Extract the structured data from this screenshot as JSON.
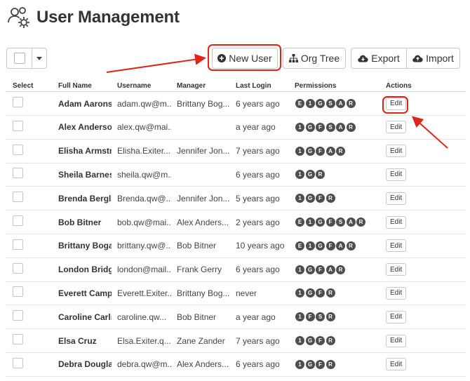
{
  "page": {
    "title": "User Management",
    "accent_color": "#e2231a",
    "badge_color": "#4e4e4e"
  },
  "toolbar": {
    "new_user_label": "New User",
    "org_tree_label": "Org Tree",
    "export_label": "Export",
    "import_label": "Import"
  },
  "table": {
    "headers": {
      "select": "Select",
      "full_name": "Full Name",
      "username": "Username",
      "manager": "Manager",
      "last_login": "Last Login",
      "permissions": "Permissions",
      "actions": "Actions"
    },
    "rows": [
      {
        "full_name": "Adam Aarons",
        "username": "adam.qw@m...",
        "manager": "Brittany Bog...",
        "last_login": "6 years ago",
        "permissions": [
          "E",
          "1",
          "G",
          "S",
          "A",
          "R"
        ],
        "action": "Edit"
      },
      {
        "full_name": "Alex Anderson",
        "username": "alex.qw@mai...",
        "manager": "",
        "last_login": "a year ago",
        "permissions": [
          "1",
          "G",
          "F",
          "S",
          "A",
          "R"
        ],
        "action": "Edit"
      },
      {
        "full_name": "Elisha Armstrong",
        "username": "Elisha.Exiter...",
        "manager": "Jennifer Jon...",
        "last_login": "7 years ago",
        "permissions": [
          "1",
          "G",
          "F",
          "A",
          "R"
        ],
        "action": "Edit"
      },
      {
        "full_name": "Sheila Barnes",
        "username": "sheila.qw@m...",
        "manager": "",
        "last_login": "6 years ago",
        "permissions": [
          "1",
          "G",
          "R"
        ],
        "action": "Edit"
      },
      {
        "full_name": "Brenda Berglan",
        "username": "Brenda.qw@...",
        "manager": "Jennifer Jon...",
        "last_login": "5 years ago",
        "permissions": [
          "1",
          "G",
          "F",
          "R"
        ],
        "action": "Edit"
      },
      {
        "full_name": "Bob Bitner",
        "username": "bob.qw@mai...",
        "manager": "Alex Anders...",
        "last_login": "2 years ago",
        "permissions": [
          "E",
          "1",
          "G",
          "F",
          "S",
          "A",
          "R"
        ],
        "action": "Edit"
      },
      {
        "full_name": "Brittany Bogart",
        "username": "brittany.qw@...",
        "manager": "Bob Bitner",
        "last_login": "10 years ago",
        "permissions": [
          "E",
          "1",
          "G",
          "F",
          "A",
          "R"
        ],
        "action": "Edit"
      },
      {
        "full_name": "London Bridges",
        "username": "london@mail...",
        "manager": "Frank Gerry",
        "last_login": "6 years ago",
        "permissions": [
          "1",
          "G",
          "F",
          "A",
          "R"
        ],
        "action": "Edit"
      },
      {
        "full_name": "Everett Campbell",
        "username": "Everett.Exiter...",
        "manager": "Brittany Bog...",
        "last_login": "never",
        "permissions": [
          "1",
          "G",
          "F",
          "R"
        ],
        "action": "Edit"
      },
      {
        "full_name": "Caroline Carlson",
        "username": "caroline.qw...",
        "manager": "Bob Bitner",
        "last_login": "a year ago",
        "permissions": [
          "1",
          "F",
          "S",
          "R"
        ],
        "action": "Edit"
      },
      {
        "full_name": "Elsa Cruz",
        "username": "Elsa.Exiter.q...",
        "manager": "Zane Zander",
        "last_login": "7 years ago",
        "permissions": [
          "1",
          "G",
          "F",
          "R"
        ],
        "action": "Edit"
      },
      {
        "full_name": "Debra Douglas",
        "username": "debra.qw@m...",
        "manager": "Alex Anders...",
        "last_login": "6 years ago",
        "permissions": [
          "1",
          "G",
          "F",
          "R"
        ],
        "action": "Edit"
      }
    ]
  }
}
